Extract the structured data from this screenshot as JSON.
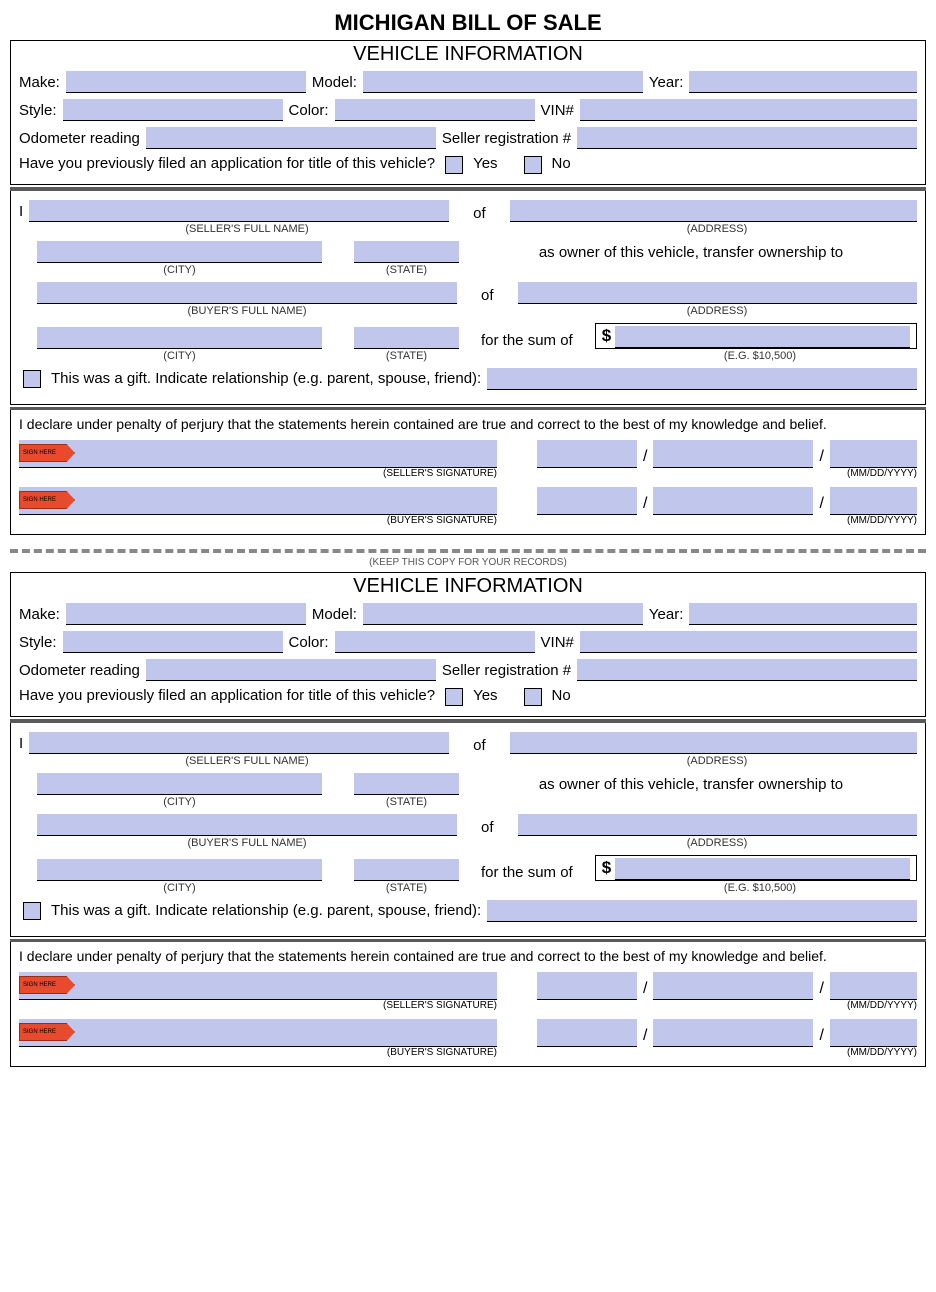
{
  "title": "MICHIGAN BILL OF SALE",
  "vehicle_info_header": "VEHICLE INFORMATION",
  "labels": {
    "make": "Make:",
    "model": "Model:",
    "year": "Year:",
    "style": "Style:",
    "color": "Color:",
    "vin": "VIN#",
    "odometer": "Odometer reading",
    "seller_reg": "Seller registration #",
    "title_q": "Have you previously filed an application for title of this vehicle?",
    "yes": "Yes",
    "no": "No",
    "I": "I",
    "of": "of",
    "seller_full": "(SELLER'S FULL NAME)",
    "address": "(ADDRESS)",
    "city": "(CITY)",
    "state": "(STATE)",
    "owner_transfer": "as owner of this vehicle, transfer ownership to",
    "buyer_full": "(BUYER'S FULL NAME)",
    "for_sum": "for the sum of",
    "dollar": "$",
    "eg_amount": "(E.G. $10,500)",
    "gift": "This was a gift. Indicate relationship (e.g. parent, spouse, friend):",
    "declare": "I declare under penalty of perjury that the statements herein contained are true and correct to the best of my knowledge and belief.",
    "seller_sig": "(SELLER'S SIGNATURE)",
    "buyer_sig": "(BUYER'S SIGNATURE)",
    "date_fmt": "(MM/DD/YYYY)",
    "sign_here": "SIGN HERE",
    "keep_copy": "(KEEP THIS COPY FOR YOUR RECORDS)"
  }
}
